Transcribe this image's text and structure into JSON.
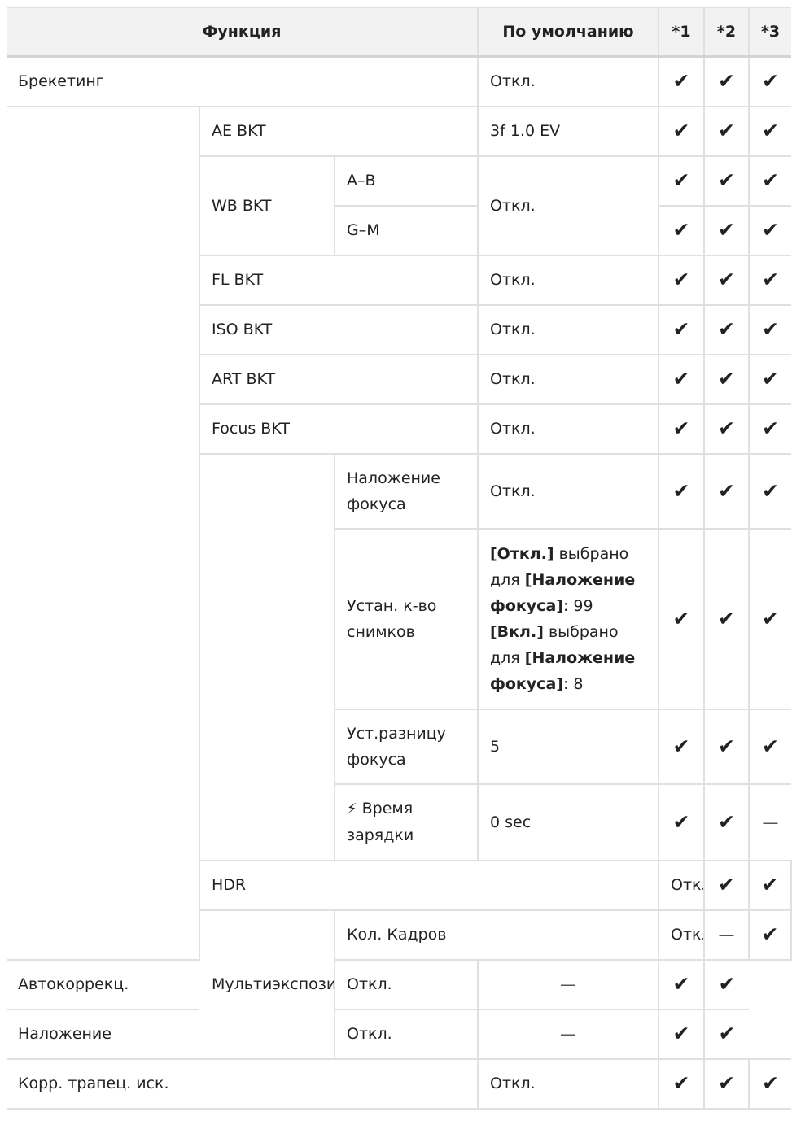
{
  "header": {
    "function": "Функция",
    "default": "По умолчанию",
    "m1": "*1",
    "m2": "*2",
    "m3": "*3"
  },
  "symbols": {
    "check": "✔",
    "dash": "—",
    "flash": "⚡"
  },
  "rows": {
    "bracketing": {
      "label": "Брекетинг",
      "default": "Откл."
    },
    "ae_bkt": {
      "label": "AE BKT",
      "default": "3f 1.0 EV"
    },
    "wb_bkt": {
      "label": "WB BKT",
      "default": "Откл.",
      "sub1": "A–B",
      "sub2": "G–M"
    },
    "fl_bkt": {
      "label": "FL BKT",
      "default": "Откл."
    },
    "iso_bkt": {
      "label": "ISO BKT",
      "default": "Откл."
    },
    "art_bkt": {
      "label": "ART BKT",
      "default": "Откл."
    },
    "focus_bkt": {
      "label": "Focus BKT",
      "default": "Откл."
    },
    "focus_stack": {
      "line1": "Наложение",
      "line2": "фокуса",
      "default": "Откл."
    },
    "shots": {
      "line1": "Устан. к-во",
      "line2": "снимков",
      "off_label": "[Откл.]",
      "selected_for": "выбрано для",
      "stack_label": "[Наложение фокуса]",
      "off_value": ": 99",
      "on_label": "[Вкл.]",
      "on_value": ": 8"
    },
    "focus_diff": {
      "line1": "Уст.разницу",
      "line2": "фокуса",
      "default": "5"
    },
    "charge_time": {
      "line1": "Время",
      "line2": "зарядки",
      "default": "0 sec"
    },
    "hdr": {
      "label": "HDR",
      "default": "Откл."
    },
    "multi_exposure": {
      "label": "Мультиэкспозиция"
    },
    "frames": {
      "label": "Кол. Кадров",
      "default": "Откл."
    },
    "auto_corr": {
      "label": "Автокоррекц.",
      "default": "Откл."
    },
    "overlay": {
      "label": "Наложение",
      "default": "Откл."
    },
    "keystone": {
      "label": "Корр. трапец. иск.",
      "default": "Откл."
    }
  }
}
